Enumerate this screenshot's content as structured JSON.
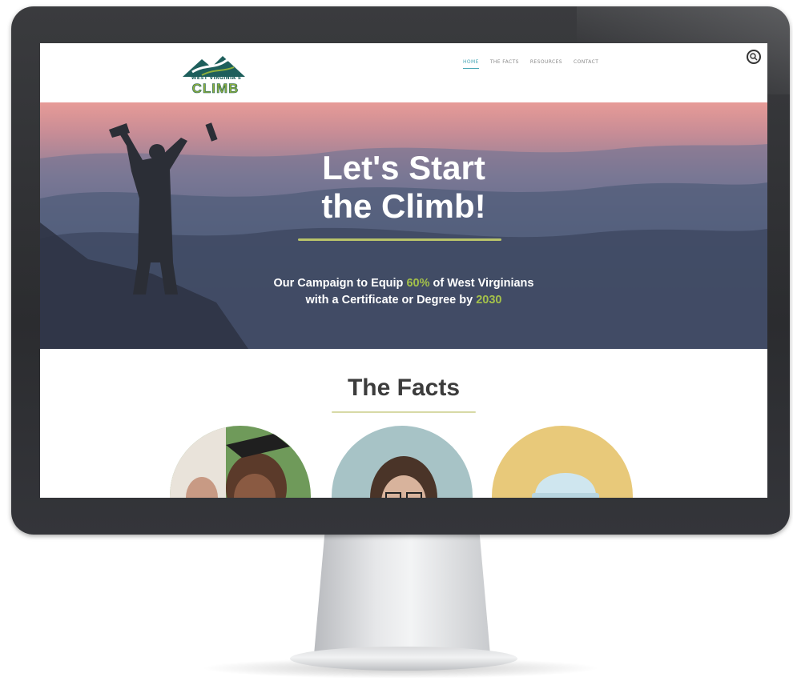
{
  "logo": {
    "top_text": "WEST VIRGINIA'S",
    "main_text": "CLIMB"
  },
  "nav": {
    "items": [
      {
        "label": "HOME",
        "active": true
      },
      {
        "label": "THE FACTS",
        "active": false
      },
      {
        "label": "RESOURCES",
        "active": false
      },
      {
        "label": "CONTACT",
        "active": false
      }
    ],
    "search_icon": "search-icon"
  },
  "hero": {
    "title_line1": "Let's Start",
    "title_line2": "the Climb!",
    "sub_part1": "Our Campaign to Equip ",
    "sub_accent1": "60%",
    "sub_part2": " of West Virginians",
    "sub_part3": "with a Certificate or Degree by ",
    "sub_accent2": "2030"
  },
  "facts": {
    "title": "The Facts"
  },
  "colors": {
    "accent_green": "#a4c14a",
    "nav_active": "#4aa7b5",
    "logo_teal": "#1e5f5c"
  }
}
